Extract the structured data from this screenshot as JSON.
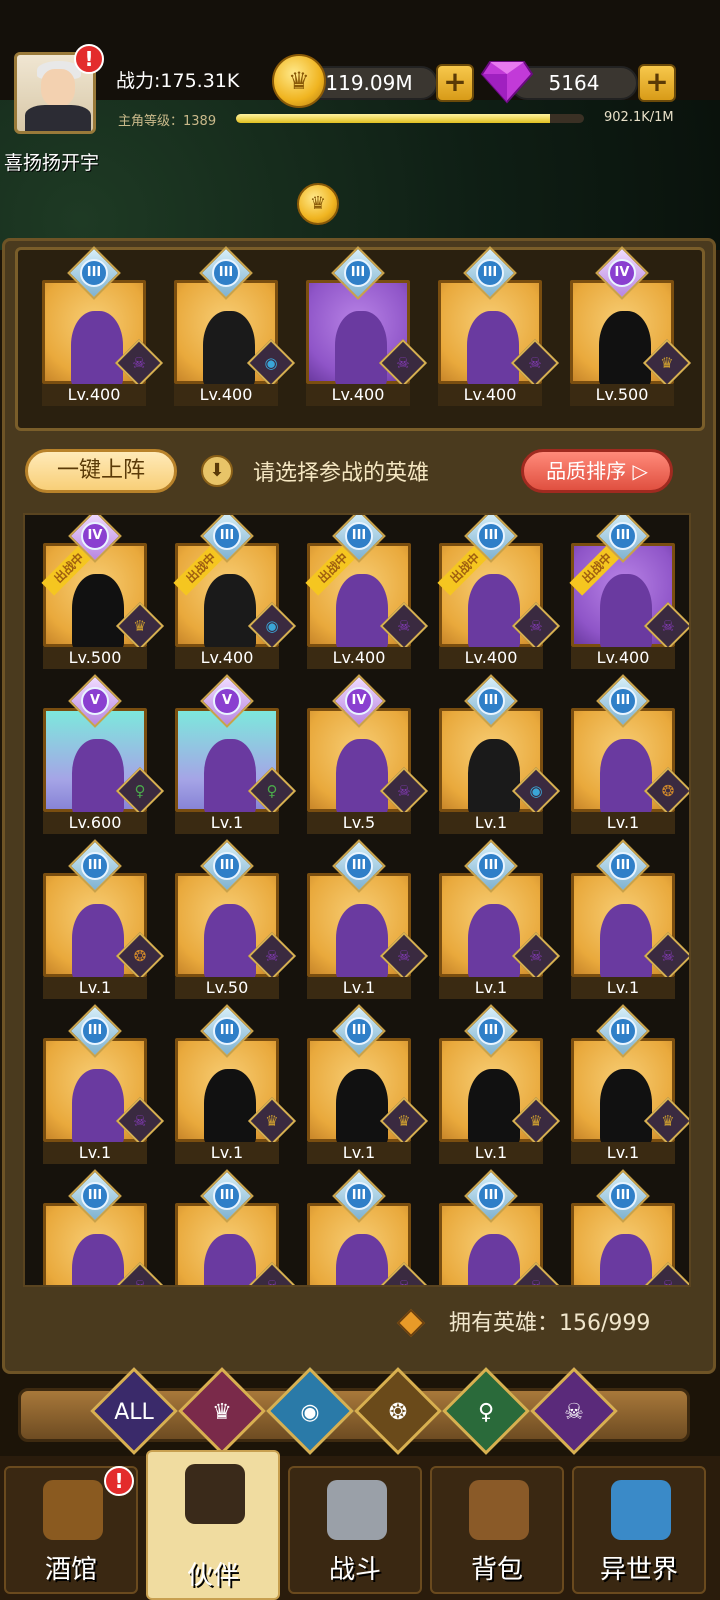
{
  "header": {
    "power_label": "战力:175.31K",
    "gold": "119.09M",
    "gems": "5164",
    "level_label": "主角等级：1389",
    "xp_text": "902.1K/1M",
    "xp_fraction": 0.902,
    "alert": "!",
    "coin_glyph": "♛",
    "plus": "+"
  },
  "player_name": "喜扬扬开宇",
  "team": [
    {
      "level": "Lv.400",
      "tier": "III",
      "bg": "orange",
      "faction": "demon"
    },
    {
      "level": "Lv.400",
      "tier": "III",
      "bg": "orange",
      "faction": "ocean"
    },
    {
      "level": "Lv.400",
      "tier": "III",
      "bg": "purple",
      "faction": "demon"
    },
    {
      "level": "Lv.400",
      "tier": "III",
      "bg": "orange",
      "faction": "demon"
    },
    {
      "level": "Lv.500",
      "tier": "IV",
      "bg": "orange",
      "faction": "crown"
    }
  ],
  "controls": {
    "auto_deploy": "一键上阵",
    "hint": "请选择参战的英雄",
    "sort": "品质排序 ▷",
    "down": "⬇"
  },
  "in_battle_label": "出战中",
  "heroes": [
    {
      "level": "Lv.500",
      "tier": "IV",
      "bg": "orange",
      "deployed": true,
      "faction": "crown"
    },
    {
      "level": "Lv.400",
      "tier": "III",
      "bg": "orange",
      "deployed": true,
      "faction": "ocean"
    },
    {
      "level": "Lv.400",
      "tier": "III",
      "bg": "orange",
      "deployed": true,
      "faction": "demon"
    },
    {
      "level": "Lv.400",
      "tier": "III",
      "bg": "orange",
      "deployed": true,
      "faction": "demon"
    },
    {
      "level": "Lv.400",
      "tier": "III",
      "bg": "purple",
      "deployed": true,
      "faction": "demon"
    },
    {
      "level": "Lv.600",
      "tier": "V",
      "bg": "teal",
      "deployed": false,
      "faction": "elf"
    },
    {
      "level": "Lv.1",
      "tier": "V",
      "bg": "teal",
      "deployed": false,
      "faction": "elf"
    },
    {
      "level": "Lv.5",
      "tier": "IV",
      "bg": "orange",
      "deployed": false,
      "faction": "demon"
    },
    {
      "level": "Lv.1",
      "tier": "III",
      "bg": "orange",
      "deployed": false,
      "faction": "ocean"
    },
    {
      "level": "Lv.1",
      "tier": "III",
      "bg": "orange",
      "deployed": false,
      "faction": "beast"
    },
    {
      "level": "Lv.1",
      "tier": "III",
      "bg": "orange",
      "deployed": false,
      "faction": "beast"
    },
    {
      "level": "Lv.50",
      "tier": "III",
      "bg": "orange",
      "deployed": false,
      "faction": "demon"
    },
    {
      "level": "Lv.1",
      "tier": "III",
      "bg": "orange",
      "deployed": false,
      "faction": "demon"
    },
    {
      "level": "Lv.1",
      "tier": "III",
      "bg": "orange",
      "deployed": false,
      "faction": "demon"
    },
    {
      "level": "Lv.1",
      "tier": "III",
      "bg": "orange",
      "deployed": false,
      "faction": "demon"
    },
    {
      "level": "Lv.1",
      "tier": "III",
      "bg": "orange",
      "deployed": false,
      "faction": "demon"
    },
    {
      "level": "Lv.1",
      "tier": "III",
      "bg": "orange",
      "deployed": false,
      "faction": "crown"
    },
    {
      "level": "Lv.1",
      "tier": "III",
      "bg": "orange",
      "deployed": false,
      "faction": "crown"
    },
    {
      "level": "Lv.1",
      "tier": "III",
      "bg": "orange",
      "deployed": false,
      "faction": "crown"
    },
    {
      "level": "Lv.1",
      "tier": "III",
      "bg": "orange",
      "deployed": false,
      "faction": "crown"
    },
    {
      "level": "",
      "tier": "III",
      "bg": "orange",
      "deployed": false,
      "faction": "demon"
    },
    {
      "level": "",
      "tier": "III",
      "bg": "orange",
      "deployed": false,
      "faction": "demon"
    },
    {
      "level": "",
      "tier": "III",
      "bg": "orange",
      "deployed": false,
      "faction": "demon"
    },
    {
      "level": "",
      "tier": "III",
      "bg": "orange",
      "deployed": false,
      "faction": "demon"
    },
    {
      "level": "",
      "tier": "III",
      "bg": "orange",
      "deployed": false,
      "faction": "demon"
    }
  ],
  "owned": "拥有英雄：156/999",
  "filters": [
    {
      "label": "ALL",
      "name": "all"
    },
    {
      "label": "♛",
      "name": "crown"
    },
    {
      "label": "◉",
      "name": "ocean"
    },
    {
      "label": "❂",
      "name": "beast"
    },
    {
      "label": "♀",
      "name": "elf"
    },
    {
      "label": "☠",
      "name": "demon"
    }
  ],
  "nav": [
    {
      "label": "酒馆",
      "icon": "beer-mug-icon",
      "active": false,
      "alert": true
    },
    {
      "label": "伙伴",
      "icon": "partner-icon",
      "active": true,
      "alert": false
    },
    {
      "label": "战斗",
      "icon": "crossed-swords-icon",
      "active": false,
      "alert": false
    },
    {
      "label": "背包",
      "icon": "backpack-icon",
      "active": false,
      "alert": false
    },
    {
      "label": "异世界",
      "icon": "portal-icon",
      "active": false,
      "alert": false
    }
  ],
  "colors": {
    "gold": "#f0b420",
    "gem": "#c23ad8",
    "orange_card": "#e9a93c",
    "purple_card": "#8f55c8",
    "teal_card": "#7de8dc",
    "sort_button": "#e05040"
  }
}
